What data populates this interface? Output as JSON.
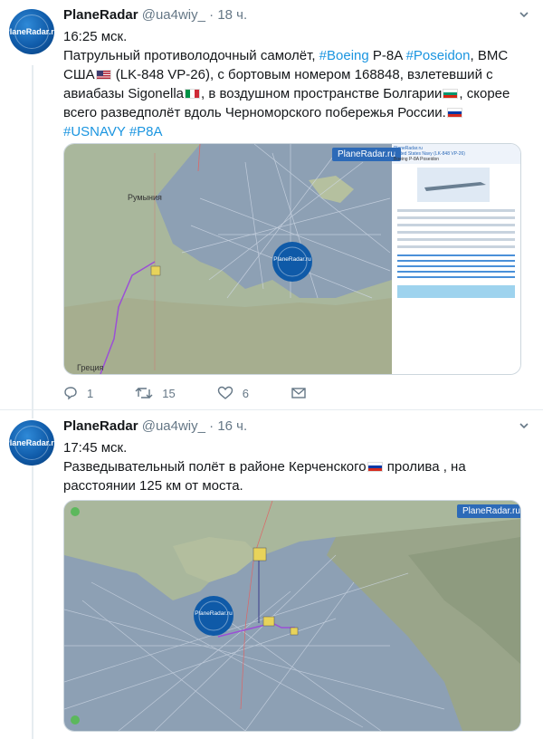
{
  "tweets": [
    {
      "avatar_text": "PlaneRadar.ru",
      "name": "PlaneRadar",
      "handle": "@ua4wiy_",
      "separator": "·",
      "time": "18 ч.",
      "time_line": "16:25 мск.",
      "text_parts": {
        "p1": "Патрульный противолодочный самолёт, ",
        "tag_boeing": "#Boeing",
        "p2": " P-8A ",
        "tag_poseidon": "#Poseidon",
        "p3": ", ВМС США",
        "p4": " (LK-848 VP-26), с бортовым номером 168848, взлетевший с авиабазы Sigonella",
        "p5": ", в воздушном пространстве Болгарии",
        "p6": ", скорее всего  разведполёт вдоль Черноморского побережья России.",
        "tag_usnavy": "#USNAVY",
        "tag_p8a": "#P8A"
      },
      "map": {
        "brand": "PlaneRadar.ru",
        "logo_text": "PlaneRadar.ru",
        "labels": [
          "Румыния",
          "Греция"
        ],
        "info_panel": {
          "brand": "PlaneRadar.ru",
          "title": "United States Navy (LK-848 VP-26)",
          "aircraft": "Boeing P-8A Poseidon"
        }
      },
      "actions": {
        "replies": "1",
        "retweets": "15",
        "likes": "6"
      }
    },
    {
      "avatar_text": "PlaneRadar.ru",
      "name": "PlaneRadar",
      "handle": "@ua4wiy_",
      "separator": "·",
      "time": "16 ч.",
      "time_line": "17:45 мск.",
      "text_parts": {
        "p1": "Разведывательный полёт в районе Керченского",
        "p2": " пролива , на расстоянии 125 км от моста."
      },
      "map": {
        "brand": "PlaneRadar.ru",
        "logo_text": "PlaneRadar.ru"
      }
    }
  ],
  "colors": {
    "link": "#1b95e0",
    "muted": "#657786",
    "brand_blue": "#2c6ab8",
    "track": "#9b4fd6"
  },
  "icons": [
    "reply-icon",
    "retweet-icon",
    "like-icon",
    "message-icon",
    "chevron-down-icon"
  ]
}
